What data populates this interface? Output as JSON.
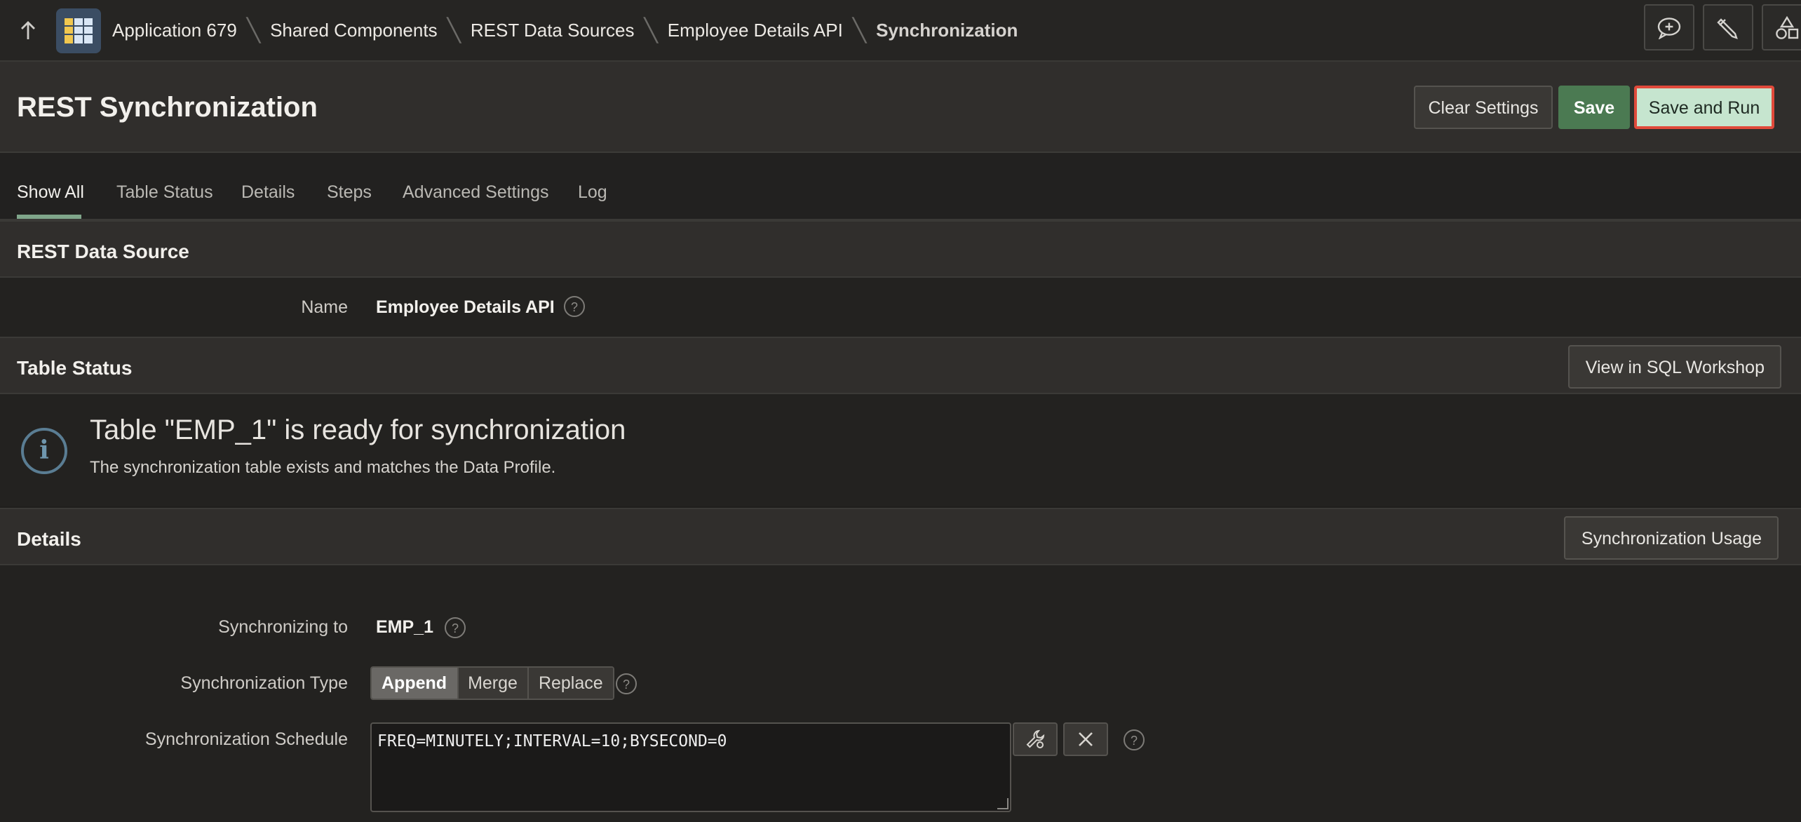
{
  "breadcrumb": {
    "items": [
      "Application 679",
      "Shared Components",
      "REST Data Sources",
      "Employee Details API"
    ],
    "current": "Synchronization"
  },
  "page": {
    "title": "REST Synchronization",
    "buttons": {
      "clear": "Clear Settings",
      "save": "Save",
      "save_and_run": "Save and Run"
    }
  },
  "tabs": [
    "Show All",
    "Table Status",
    "Details",
    "Steps",
    "Advanced Settings",
    "Log"
  ],
  "active_tab": "Show All",
  "rest_data_source": {
    "title": "REST Data Source",
    "name_label": "Name",
    "name_value": "Employee Details API"
  },
  "table_status": {
    "title": "Table Status",
    "button": "View in SQL Workshop",
    "message_title": "Table \"EMP_1\" is ready for synchronization",
    "message_desc": "The synchronization table exists and matches the Data Profile."
  },
  "details": {
    "title": "Details",
    "button": "Synchronization Usage",
    "sync_to_label": "Synchronizing to",
    "sync_to_value": "EMP_1",
    "sync_type_label": "Synchronization Type",
    "sync_type_options": [
      "Append",
      "Merge",
      "Replace"
    ],
    "sync_type_selected": "Append",
    "schedule_label": "Synchronization Schedule",
    "schedule_value": "FREQ=MINUTELY;INTERVAL=10;BYSECOND=0"
  },
  "help_glyph": "?",
  "colors": {
    "save": "#4b7a52",
    "save_and_run": "#c6e5cf",
    "highlight_border": "#e14a3b",
    "tab_underline": "#7fa58a",
    "info": "#5a7d93"
  }
}
